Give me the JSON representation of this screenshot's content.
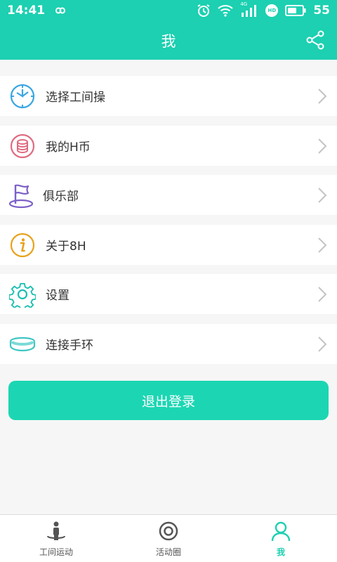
{
  "status_bar": {
    "time": "14:41",
    "battery_percent": "55",
    "network_label": "4G",
    "hd_label": "HD"
  },
  "header": {
    "title": "我",
    "share_icon": "share-icon"
  },
  "menu": {
    "items": [
      {
        "label": "选择工间操",
        "icon": "clock-icon"
      },
      {
        "label": "我的H币",
        "icon": "coins-icon"
      },
      {
        "label": "俱乐部",
        "icon": "flag-icon"
      },
      {
        "label": "关于8H",
        "icon": "info-icon"
      },
      {
        "label": "设置",
        "icon": "gear-icon"
      },
      {
        "label": "连接手环",
        "icon": "bracelet-icon"
      }
    ]
  },
  "logout_label": "退出登录",
  "tabs": [
    {
      "label": "工间运动",
      "icon": "exercise-person-icon",
      "active": false
    },
    {
      "label": "活动圈",
      "icon": "target-icon",
      "active": false
    },
    {
      "label": "我",
      "icon": "user-icon",
      "active": true
    }
  ],
  "colors": {
    "primary": "#1cd0b1",
    "background": "#f6f6f6",
    "clock_icon": "#3aa6e3",
    "coins_icon": "#e06b80",
    "flag_icon": "#7c60c7",
    "info_icon": "#e8a21a",
    "gear_icon": "#1cbfb0",
    "bracelet_icon": "#3fc6c4"
  }
}
